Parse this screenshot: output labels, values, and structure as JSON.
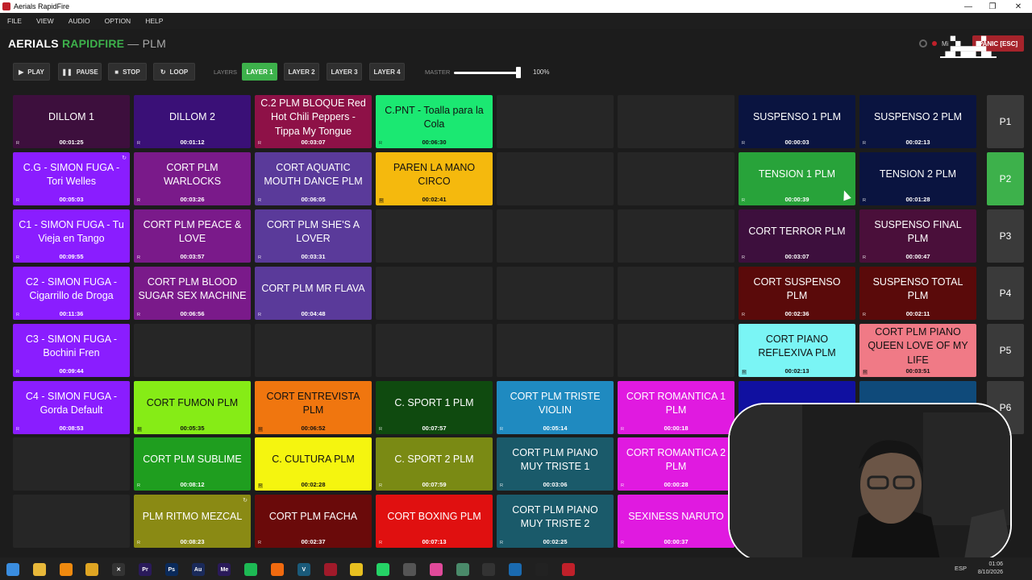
{
  "window": {
    "title": "Aerials RapidFire",
    "controls": [
      "—",
      "❐",
      "✕"
    ]
  },
  "menu": [
    "FILE",
    "VIEW",
    "AUDIO",
    "OPTION",
    "HELP"
  ],
  "brand": {
    "part1": "AERIALS",
    "part2": "RAPIDFIRE",
    "part3": "— PLM"
  },
  "header": {
    "panic_label": "PANIC [ESC]",
    "mini_label": "Mi"
  },
  "transport": {
    "play": "PLAY",
    "pause": "PAUSE",
    "stop": "STOP",
    "loop": "LOOP"
  },
  "layers": {
    "label": "LAYERS",
    "items": [
      "LAYER 1",
      "LAYER 2",
      "LAYER 3",
      "LAYER 4"
    ],
    "active": "LAYER 1"
  },
  "master": {
    "label": "MASTER",
    "value_label": "100%",
    "level": 1.0
  },
  "colors": {
    "accent": "#3db14b",
    "panic": "#a6232b"
  },
  "cells": [
    {
      "name": "DILLOM 1",
      "time": "00:01:25",
      "color": "#3d0f3d"
    },
    {
      "name": "DILLOM 2",
      "time": "00:01:12",
      "color": "#3a1077"
    },
    {
      "name": "C.2 PLM BLOQUE Red Hot Chili Peppers - Tippa My Tongue",
      "time": "00:03:07",
      "color": "#8e1147"
    },
    {
      "name": "C.PNT - Toalla para la Cola",
      "time": "00:06:30",
      "color": "#1be872",
      "dark": true
    },
    null,
    null,
    {
      "name": "SUSPENSO 1 PLM",
      "time": "00:00:03",
      "color": "#0a1440"
    },
    {
      "name": "SUSPENSO 2 PLM",
      "time": "00:02:13",
      "color": "#0a1440"
    },
    {
      "name": "C.G - SIMON FUGA - Tori Welles",
      "time": "00:05:03",
      "color": "#8a1dff",
      "loop": true
    },
    {
      "name": "CORT PLM WARLOCKS",
      "time": "00:03:26",
      "color": "#7a1a8a"
    },
    {
      "name": "CORT AQUATIC MOUTH DANCE PLM",
      "time": "00:06:05",
      "color": "#5a3a9a"
    },
    {
      "name": "PAREN LA MANO CIRCO",
      "time": "00:02:41",
      "color": "#f5b90d",
      "dark": true,
      "rbox": true
    },
    null,
    null,
    {
      "name": "TENSION 1 PLM",
      "time": "00:00:39",
      "color": "#28a33a"
    },
    {
      "name": "TENSION 2 PLM",
      "time": "00:01:28",
      "color": "#0a1440"
    },
    {
      "name": "C1 - SIMON FUGA - Tu Vieja en Tango",
      "time": "00:09:55",
      "color": "#8a1dff"
    },
    {
      "name": "CORT PLM PEACE & LOVE",
      "time": "00:03:57",
      "color": "#7a1a8a"
    },
    {
      "name": "CORT PLM SHE'S A LOVER",
      "time": "00:03:31",
      "color": "#5a3a9a"
    },
    null,
    null,
    null,
    {
      "name": "CORT TERROR PLM",
      "time": "00:03:07",
      "color": "#3d0f3d"
    },
    {
      "name": "SUSPENSO FINAL PLM",
      "time": "00:00:47",
      "color": "#4a0f3a"
    },
    {
      "name": "C2 - SIMON FUGA - Cigarrillo de Droga",
      "time": "00:11:36",
      "color": "#8a1dff"
    },
    {
      "name": "CORT PLM BLOOD SUGAR SEX MACHINE",
      "time": "00:06:56",
      "color": "#7a1a8a"
    },
    {
      "name": "CORT PLM MR FLAVA",
      "time": "00:04:48",
      "color": "#5a3a9a"
    },
    null,
    null,
    null,
    {
      "name": "CORT SUSPENSO PLM",
      "time": "00:02:36",
      "color": "#5a0a0a"
    },
    {
      "name": "SUSPENSO TOTAL PLM",
      "time": "00:02:11",
      "color": "#5a0a0a"
    },
    {
      "name": "C3 - SIMON FUGA - Bochini  Fren",
      "time": "00:09:44",
      "color": "#8a1dff"
    },
    null,
    null,
    null,
    null,
    null,
    {
      "name": "CORT PIANO REFLEXIVA PLM",
      "time": "00:02:13",
      "color": "#7af5f5",
      "dark": true,
      "rbox": true
    },
    {
      "name": "CORT PLM PIANO QUEEN LOVE OF MY LIFE",
      "time": "00:03:51",
      "color": "#f07a86",
      "dark": true,
      "rbox": true
    },
    {
      "name": "C4 - SIMON FUGA - Gorda Default",
      "time": "00:08:53",
      "color": "#8a1dff"
    },
    {
      "name": "CORT FUMON PLM",
      "time": "00:05:35",
      "color": "#86ec16",
      "dark": true,
      "rbox": true
    },
    {
      "name": "CORT ENTREVISTA PLM",
      "time": "00:06:52",
      "color": "#f0760f",
      "dark": true,
      "rbox": true
    },
    {
      "name": "C. SPORT 1 PLM",
      "time": "00:07:57",
      "color": "#0f4a0f"
    },
    {
      "name": "CORT PLM TRISTE VIOLIN",
      "time": "00:05:14",
      "color": "#1f8ac0"
    },
    {
      "name": "CORT ROMANTICA 1 PLM",
      "time": "00:00:18",
      "color": "#e01ae0"
    },
    {
      "name": "",
      "time": "",
      "color": "#1010a0"
    },
    {
      "name": "",
      "time": "",
      "color": "#0f4a7a"
    },
    null,
    {
      "name": "CORT PLM SUBLIME",
      "time": "00:08:12",
      "color": "#1f9e1f"
    },
    {
      "name": "C. CULTURA PLM",
      "time": "00:02:28",
      "color": "#f5f50f",
      "dark": true,
      "rbox": true
    },
    {
      "name": "C. SPORT 2 PLM",
      "time": "00:07:59",
      "color": "#7a8a14"
    },
    {
      "name": "CORT PLM PIANO MUY TRISTE 1",
      "time": "00:03:06",
      "color": "#1a5a6a"
    },
    {
      "name": "CORT ROMANTICA 2 PLM",
      "time": "00:00:28",
      "color": "#e01ae0"
    },
    null,
    null,
    null,
    {
      "name": "PLM RITMO MEZCAL",
      "time": "00:08:23",
      "color": "#8a8a14",
      "loop": true
    },
    {
      "name": "CORT PLM FACHA",
      "time": "00:02:37",
      "color": "#6a0a0a"
    },
    {
      "name": "CORT BOXING PLM",
      "time": "00:07:13",
      "color": "#e01010"
    },
    {
      "name": "CORT PLM PIANO MUY TRISTE 2",
      "time": "00:02:25",
      "color": "#1a5a6a"
    },
    {
      "name": "SEXINESS NARUTO",
      "time": "00:00:37",
      "color": "#e01ae0"
    },
    null,
    null
  ],
  "pages": [
    "P1",
    "P2",
    "P3",
    "P4",
    "P5",
    "P6"
  ],
  "active_page": "P2",
  "taskbar": {
    "apps": [
      "start",
      "explorer",
      "vlc",
      "chrome",
      "x",
      "Pr",
      "Ps",
      "Au",
      "Me",
      "spotify",
      "search",
      "V",
      "red",
      "yellow",
      "whatsapp",
      "calc",
      "photos",
      "notes",
      "obs",
      "grid",
      "terminal",
      "rapidfire"
    ],
    "lang": "ESP",
    "time": "01:06",
    "date": "8/10/2026"
  }
}
